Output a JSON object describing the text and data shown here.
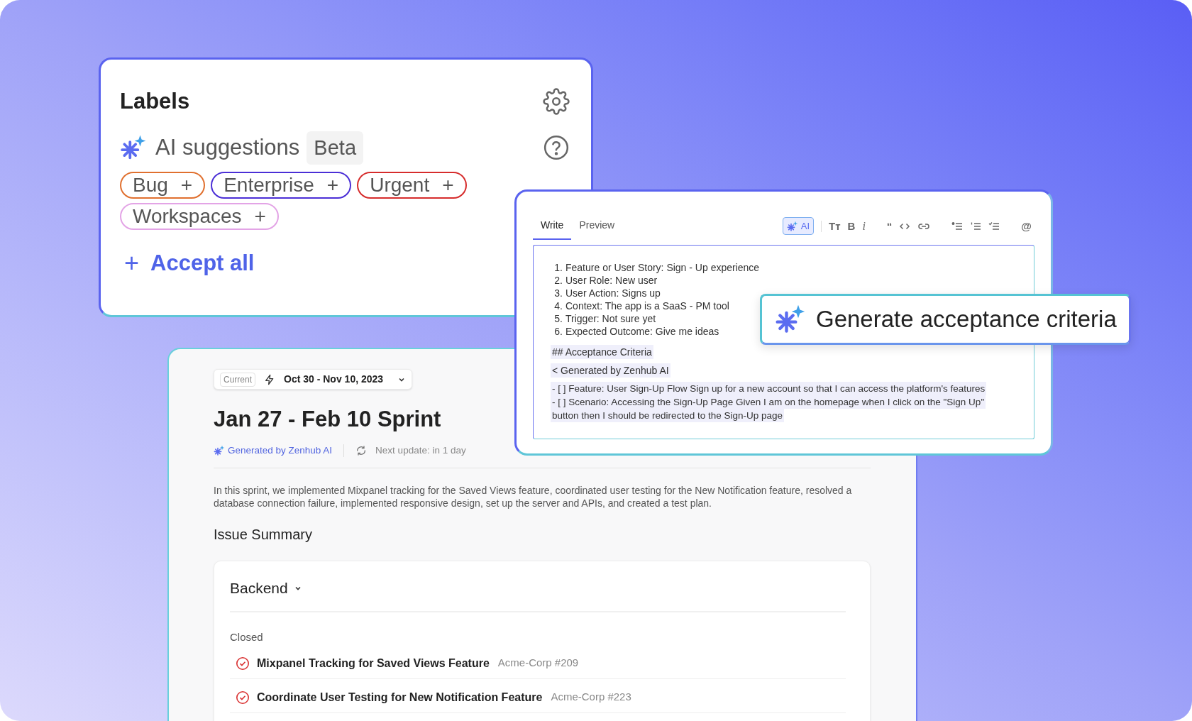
{
  "labels_card": {
    "title": "Labels",
    "ai_suggestions": {
      "label": "AI suggestions",
      "badge": "Beta"
    },
    "tags": [
      {
        "text": "Bug",
        "action": "+",
        "color": "#e0702f"
      },
      {
        "text": "Enterprise",
        "action": "+",
        "color": "#4b2fd6"
      },
      {
        "text": "Urgent",
        "action": "+",
        "color": "#d62c2c"
      },
      {
        "text": "Workspaces",
        "action": "+",
        "color": "#e3a4e6"
      }
    ],
    "accept_all": {
      "icon_text": "+",
      "label": "Accept all"
    }
  },
  "sprint_card": {
    "picker": {
      "badge": "Current",
      "range": "Oct 30 - Nov 10, 2023"
    },
    "title": "Jan 27 - Feb 10 Sprint",
    "generated_by": "Generated by Zenhub AI",
    "next_update": "Next update: in 1 day",
    "summary": "In this sprint, we implemented Mixpanel tracking for the Saved Views feature, coordinated user testing for the New Notification feature, resolved a database connection failure, implemented responsive design, set up the server and APIs, and created a test plan.",
    "section_title": "Issue Summary",
    "group": {
      "title": "Backend",
      "expanded": true,
      "status": "Closed",
      "issues": [
        {
          "title": "Mixpanel Tracking for Saved Views Feature",
          "repo": "Acme-Corp #209"
        },
        {
          "title": "Coordinate User Testing for New Notification Feature",
          "repo": "Acme-Corp #223"
        }
      ]
    }
  },
  "editor": {
    "tabs": [
      {
        "label": "Write",
        "selected": true
      },
      {
        "label": "Preview",
        "selected": false
      }
    ],
    "ai_button": {
      "label": "AI",
      "selected": true
    },
    "toolbar": [
      {
        "kind": "glyph",
        "text": "Tт"
      },
      {
        "kind": "glyph",
        "text": "B"
      },
      {
        "kind": "italic",
        "text": "i"
      },
      {
        "kind": "gap"
      },
      {
        "kind": "glyph",
        "text": "“"
      },
      {
        "kind": "code"
      },
      {
        "kind": "link"
      },
      {
        "kind": "gap"
      },
      {
        "kind": "bullets"
      },
      {
        "kind": "numbers"
      },
      {
        "kind": "tasks"
      },
      {
        "kind": "gap"
      },
      {
        "kind": "glyph",
        "text": "@"
      }
    ],
    "list": [
      {
        "number": "1.",
        "text": "Feature or User Story: Sign - Up experience"
      },
      {
        "number": "2.",
        "text": "User Role: New user"
      },
      {
        "number": "3.",
        "text": "User Action: Signs up"
      },
      {
        "number": "4.",
        "text": "Context: The app is a SaaS - PM tool"
      },
      {
        "number": "5.",
        "text": "Trigger: Not sure yet"
      },
      {
        "number": "6.",
        "text": "Expected Outcome: Give me ideas"
      }
    ],
    "generated": [
      "## Acceptance Criteria",
      "< Generated by Zenhub AI"
    ],
    "criteria": [
      "- [ ] Feature: User Sign-Up Flow Sign up for a new account so that I can access the platform's features",
      "- [ ] Scenario: Accessing the Sign-Up Page Given I am on the homepage when I click on the \"Sign Up\"",
      "button then I should be redirected to the Sign-Up page"
    ]
  },
  "generate_popup": {
    "label": "Generate acceptance criteria"
  }
}
